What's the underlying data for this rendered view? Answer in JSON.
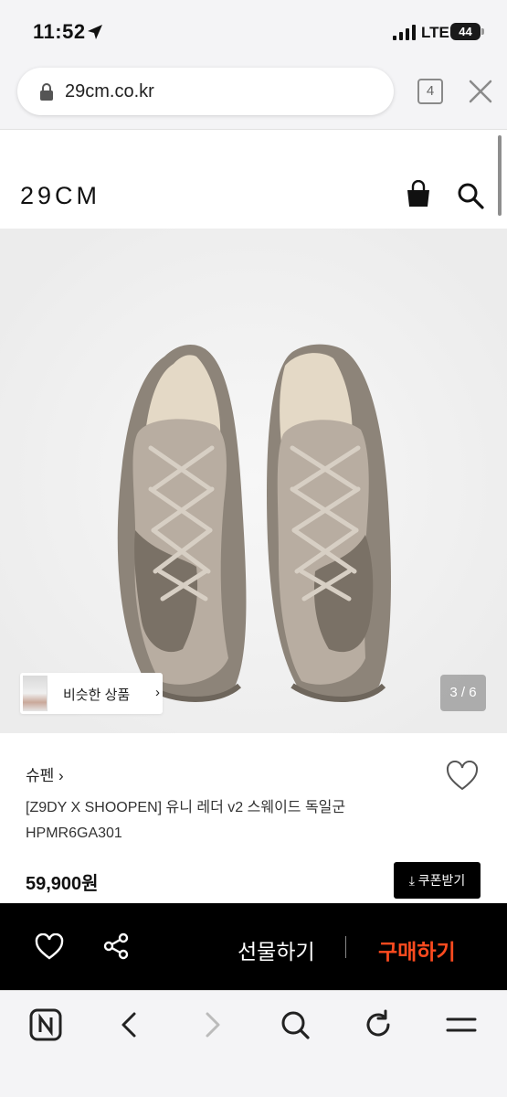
{
  "status_bar": {
    "time": "11:52",
    "network": "LTE",
    "battery": "44"
  },
  "browser": {
    "url": "29cm.co.kr",
    "tab_count": "4"
  },
  "site": {
    "logo": "29CM"
  },
  "gallery": {
    "similar_label": "비슷한 상품",
    "similar_chevron": "›",
    "pager": "3 / 6"
  },
  "product": {
    "brand": "슈펜 ›",
    "name_line1": "[Z9DY X SHOOPEN] 유니 레더 v2 스웨이드 독일군",
    "name_line2": "HPMR6GA301",
    "price": "59,900원",
    "coupon_label": "⤓ 쿠폰받기"
  },
  "buy_bar": {
    "gift_label": "선물하기",
    "buy_label": "구매하기"
  },
  "colors": {
    "buy_accent": "#ff4b1f",
    "bar_bg": "#000000",
    "hero_bg": "#f1f1f1"
  }
}
